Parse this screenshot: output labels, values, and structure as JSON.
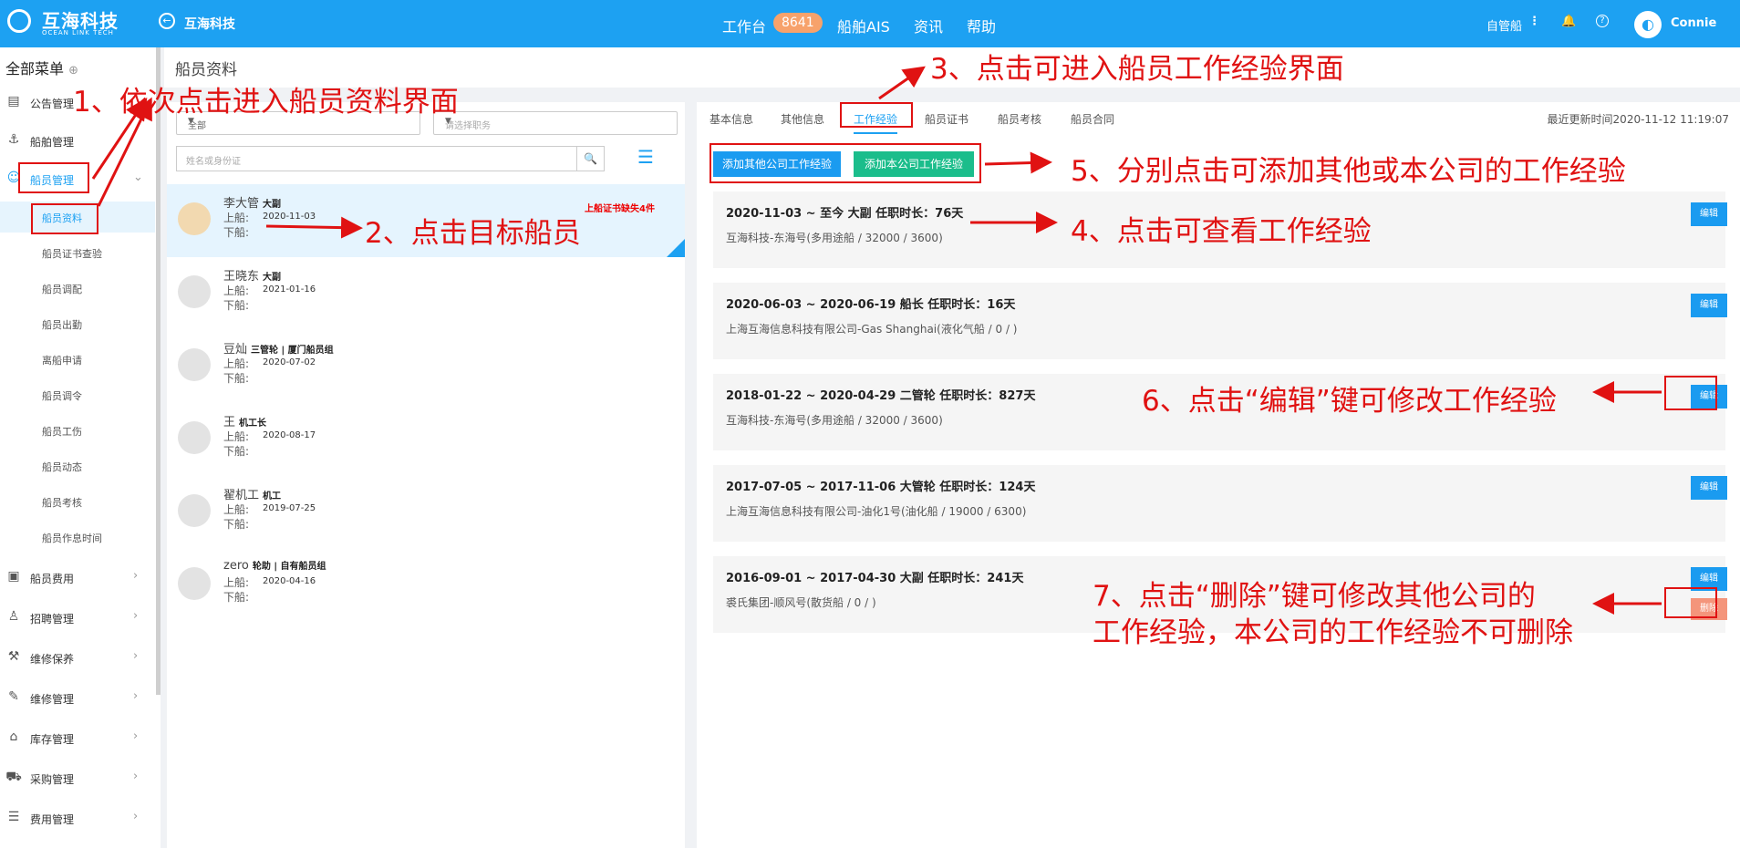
{
  "topbar": {
    "logo_text": "互海科技",
    "logo_sub": "OCEAN LINK TECH",
    "company": "互海科技",
    "nav": [
      "工作台",
      "船舶AIS",
      "资讯",
      "帮助"
    ],
    "badge": "8641",
    "ship_mode": "自管船",
    "user": "Connie"
  },
  "sidebar": {
    "title": "全部菜单",
    "items": [
      {
        "label": "公告管理",
        "icon": "notice-icon"
      },
      {
        "label": "船舶管理",
        "icon": "anchor-icon"
      },
      {
        "label": "船员管理",
        "icon": "user-icon"
      },
      {
        "label": "船员费用",
        "icon": "wallet-icon"
      },
      {
        "label": "招聘管理",
        "icon": "person-icon"
      },
      {
        "label": "维修保养",
        "icon": "tool-icon"
      },
      {
        "label": "维修管理",
        "icon": "wrench-icon"
      },
      {
        "label": "库存管理",
        "icon": "home-icon"
      },
      {
        "label": "采购管理",
        "icon": "cart-icon"
      },
      {
        "label": "费用管理",
        "icon": "database-icon"
      }
    ],
    "subitems": [
      "船员资料",
      "船员证书查验",
      "船员调配",
      "船员出勤",
      "离船申请",
      "船员调令",
      "船员工伤",
      "船员动态",
      "船员考核",
      "船员作息时间"
    ]
  },
  "page_title": "船员资料",
  "filters": {
    "select1": "全部",
    "select2_placeholder": "请选择职务",
    "search_placeholder": "姓名或身份证"
  },
  "crew": [
    {
      "name": "李大管",
      "rank": "大副",
      "board_label": "上船:",
      "board": "2020-11-03",
      "leave_label": "下船:",
      "tag": "上船证书缺失4件"
    },
    {
      "name": "王晓东",
      "rank": "大副",
      "board_label": "上船:",
      "board": "2021-01-16",
      "leave_label": "下船:"
    },
    {
      "name": "豆灿",
      "rank": "三管轮 | 厦门船员组",
      "board_label": "上船:",
      "board": "2020-07-02",
      "leave_label": "下船:"
    },
    {
      "name": "王",
      "rank": "机工长",
      "board_label": "上船:",
      "board": "2020-08-17",
      "leave_label": "下船:"
    },
    {
      "name": "翟机工",
      "rank": "机工",
      "board_label": "上船:",
      "board": "2019-07-25",
      "leave_label": "下船:"
    },
    {
      "name": "zero",
      "rank": "轮助 | 自有船员组",
      "board_label": "上船:",
      "board": "2020-04-16",
      "leave_label": "下船:"
    }
  ],
  "tabs": [
    "基本信息",
    "其他信息",
    "工作经验",
    "船员证书",
    "船员考核",
    "船员合同"
  ],
  "updated": "最近更新时间2020-11-12 11:19:07",
  "buttons": {
    "add_other": "添加其他公司工作经验",
    "add_own": "添加本公司工作经验",
    "edit": "编辑",
    "delete": "删除"
  },
  "experience": [
    {
      "header": "2020-11-03 ~ 至今  大副   任职时长：76天",
      "detail": "互海科技-东海号(多用途船 / 32000 / 3600)"
    },
    {
      "header": "2020-06-03 ~ 2020-06-19  船长   任职时长：16天",
      "detail": "上海互海信息科技有限公司-Gas Shanghai(液化气船 / 0 / )"
    },
    {
      "header": "2018-01-22 ~ 2020-04-29  二管轮   任职时长：827天",
      "detail": "互海科技-东海号(多用途船 / 32000 / 3600)"
    },
    {
      "header": "2017-07-05 ~ 2017-11-06  大管轮   任职时长：124天",
      "detail": "上海互海信息科技有限公司-油化1号(油化船 / 19000 / 6300)"
    },
    {
      "header": "2016-09-01 ~ 2017-04-30  大副   任职时长：241天",
      "detail": "裘氏集团-顺风号(散货船 / 0 / )"
    }
  ],
  "annotations": {
    "a1": "1、依次点击进入船员资料界面",
    "a2": "2、点击目标船员",
    "a3": "3、点击可进入船员工作经验界面",
    "a4": "4、点击可查看工作经验",
    "a5": "5、分别点击可添加其他或本公司的工作经验",
    "a6": "6、点击“编辑”键可修改工作经验",
    "a7_line1": "7、点击“删除”键可修改其他公司的",
    "a7_line2": "工作经验，本公司的工作经验不可删除"
  },
  "colors": {
    "primary": "#1da1f2",
    "green": "#1bbd8b",
    "annotation": "#e01212",
    "delete": "#f4957b"
  }
}
